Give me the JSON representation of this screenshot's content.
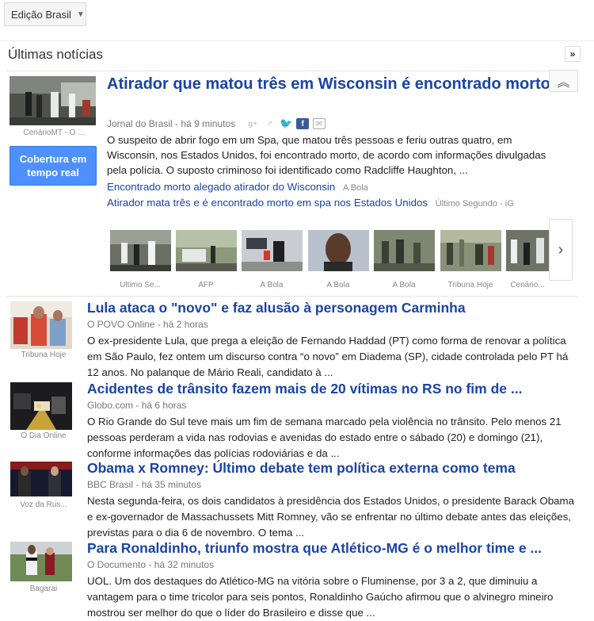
{
  "header": {
    "edition_label": "Edição Brasil"
  },
  "section": {
    "title": "Últimas notícias",
    "expand_symbol": "»"
  },
  "top_story": {
    "title": "Atirador que matou três em Wisconsin é encontrado morto",
    "source": "Jornal do Brasil",
    "time": "há 9 minutos",
    "snippet": "O suspeito de abrir fogo em um Spa, que matou três pessoas e feriu outras quatro, em Wisconsin, nos Estados Unidos, foi encontrado morto, de acordo com informações divulgadas pela polícia. O suposto criminoso foi identificado como Radcliffe Haughton, ...",
    "thumb_source": "CenárioMT - O ...",
    "coverage_label": "Cobertura em tempo real",
    "related": [
      {
        "title": "Encontrado morto alegado atirador do Wisconsin",
        "source": "A Bola"
      },
      {
        "title": "Atirador mata três e é encontrado morto em spa nos Estados Unidos",
        "source": "Último Segundo - iG"
      }
    ],
    "images": [
      {
        "caption": "Ultimo Se..."
      },
      {
        "caption": "AFP"
      },
      {
        "caption": "A Bola"
      },
      {
        "caption": "A Bola"
      },
      {
        "caption": "A Bola"
      },
      {
        "caption": "Tribuna Hoje"
      },
      {
        "caption": "Cenário..."
      }
    ]
  },
  "stories": [
    {
      "title": "Lula ataca o \"novo\" e faz alusão à personagem Carminha",
      "source": "O POVO Online",
      "time": "há 2 horas",
      "snippet": "O ex-presidente Lula, que prega a eleição de Fernando Haddad (PT) como forma de renovar a política em São Paulo, fez ontem um discurso contra “o novo” em Diadema (SP), cidade controlada pelo PT há 12 anos. No palanque de Mário Reali, candidato à ...",
      "thumb_source": "Tribuna Hoje"
    },
    {
      "title": "Acidentes de trânsito fazem mais de 20 vítimas no RS no fim de ...",
      "source": "Globo.com",
      "time": "há 6 horas",
      "snippet": "O Rio Grande do Sul teve mais um fim de semana marcado pela violência no trânsito. Pelo menos 21 pessoas perderam a vida nas rodovias e avenidas do estado entre o sábado (20) e domingo (21), conforme informações das polícias rodoviárias e da ...",
      "thumb_source": "O Dia Online"
    },
    {
      "title": "Obama x Romney: Último debate tem política externa como tema",
      "source": "BBC Brasil",
      "time": "há 35 minutos",
      "snippet": "Nesta segunda-feira, os dois candidatos à presidência dos Estados Unidos, o presidente Barack Obama e ex-governador de Massachussets Mitt Romney, vão se enfrentar no último debate antes das eleições, previstas para o dia 6 de novembro. O tema ...",
      "thumb_source": "Voz da Rus..."
    },
    {
      "title": "Para Ronaldinho, triunfo mostra que Atlético-MG é o melhor time e ...",
      "source": "O Documento",
      "time": "há 32 minutos",
      "snippet": "UOL. Um dos destaques do Atlético-MG na vitória sobre o Fluminense, por 3 a 2, que diminuiu a vantagem para o time tricolor para seis pontos, Ronaldinho Gaúcho afirmou que o alvinegro mineiro mostrou ser melhor do que o líder do Brasileiro e disse que ...",
      "thumb_source": "Bagarai"
    }
  ],
  "colors": {
    "link": "#1a44a5",
    "accent": "#4d90fe"
  }
}
